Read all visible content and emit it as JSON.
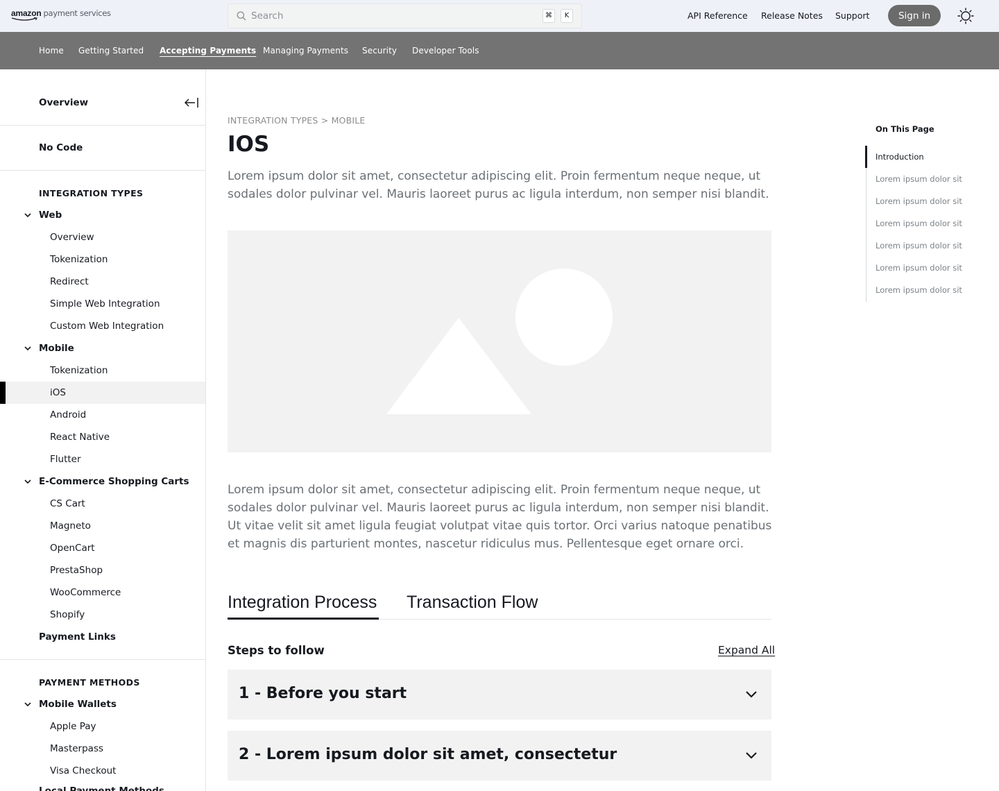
{
  "header": {
    "logo_amazon": "amazon",
    "logo_rest": "payment services",
    "search": {
      "placeholder": "Search",
      "shortcut_cmd": "⌘",
      "shortcut_key": "K"
    },
    "links": [
      "API Reference",
      "Release Notes",
      "Support"
    ],
    "signin_label": "Sign in"
  },
  "nav": {
    "items": [
      "Home",
      "Getting Started",
      "Accepting Payments",
      "Managing Payments",
      "Security",
      "Developer Tools"
    ],
    "active": "Accepting Payments"
  },
  "sidebar": {
    "overview": "Overview",
    "no_code": "No Code",
    "integration_types": {
      "title": "INTEGRATION TYPES",
      "web": {
        "label": "Web",
        "items": [
          "Overview",
          "Tokenization",
          "Redirect",
          "Simple Web Integration",
          "Custom Web Integration"
        ]
      },
      "mobile": {
        "label": "Mobile",
        "items": [
          "Tokenization",
          "iOS",
          "Android",
          "React Native",
          "Flutter"
        ]
      },
      "ecommerce": {
        "label": "E-Commerce Shopping Carts",
        "items": [
          "CS Cart",
          "Magneto",
          "OpenCart",
          "PrestaShop",
          "WooCommerce",
          "Shopify"
        ]
      },
      "payment_links": "Payment Links"
    },
    "payment_methods": {
      "title": "PAYMENT METHODS",
      "mobile_wallets": {
        "label": "Mobile Wallets",
        "items": [
          "Apple Pay",
          "Masterpass",
          "Visa Checkout"
        ]
      },
      "local_payment_methods": "Local Payment Methods"
    },
    "active_item": "iOS"
  },
  "main": {
    "breadcrumb": "INTEGRATION TYPES > MOBILE",
    "title": "IOS",
    "intro": "Lorem ipsum dolor sit amet, consectetur adipiscing elit. Proin fermentum neque neque, ut sodales dolor pulvinar vel. Mauris laoreet purus ac ligula interdum, non semper nisi blandit.",
    "body": "Lorem ipsum dolor sit amet, consectetur adipiscing elit. Proin fermentum neque neque, ut sodales dolor pulvinar vel. Mauris laoreet purus ac ligula interdum, non semper nisi blandit. Ut vitae velit sit amet ligula feugiat volutpat vitae quis tortor. Orci varius natoque penatibus et magnis dis parturient montes, nascetur ridiculus mus. Pellentesque eget ornare orci.",
    "tabs": [
      "Integration Process",
      "Transaction Flow"
    ],
    "active_tab": "Integration Process",
    "steps_title": "Steps to follow",
    "expand_all": "Expand All",
    "accordion": [
      "1 - Before you start",
      "2 - Lorem ipsum dolor sit amet, consectetur"
    ]
  },
  "toc": {
    "title": "On This Page",
    "items": [
      "Introduction",
      "Lorem ipsum dolor sit",
      "Lorem ipsum dolor sit",
      "Lorem ipsum dolor sit",
      "Lorem ipsum dolor sit",
      "Lorem ipsum dolor sit",
      "Lorem ipsum dolor sit"
    ],
    "active": "Introduction"
  },
  "colors": {
    "topbar_bg": "#eef1f7",
    "navbar_bg": "#737373",
    "signin_bg": "#6b6b6b",
    "placeholder_bg": "#f2f2f2",
    "text": "#16191f"
  },
  "icons": [
    "search-icon",
    "collapse-sidebar-icon",
    "chevron-down-icon",
    "sun-icon"
  ]
}
